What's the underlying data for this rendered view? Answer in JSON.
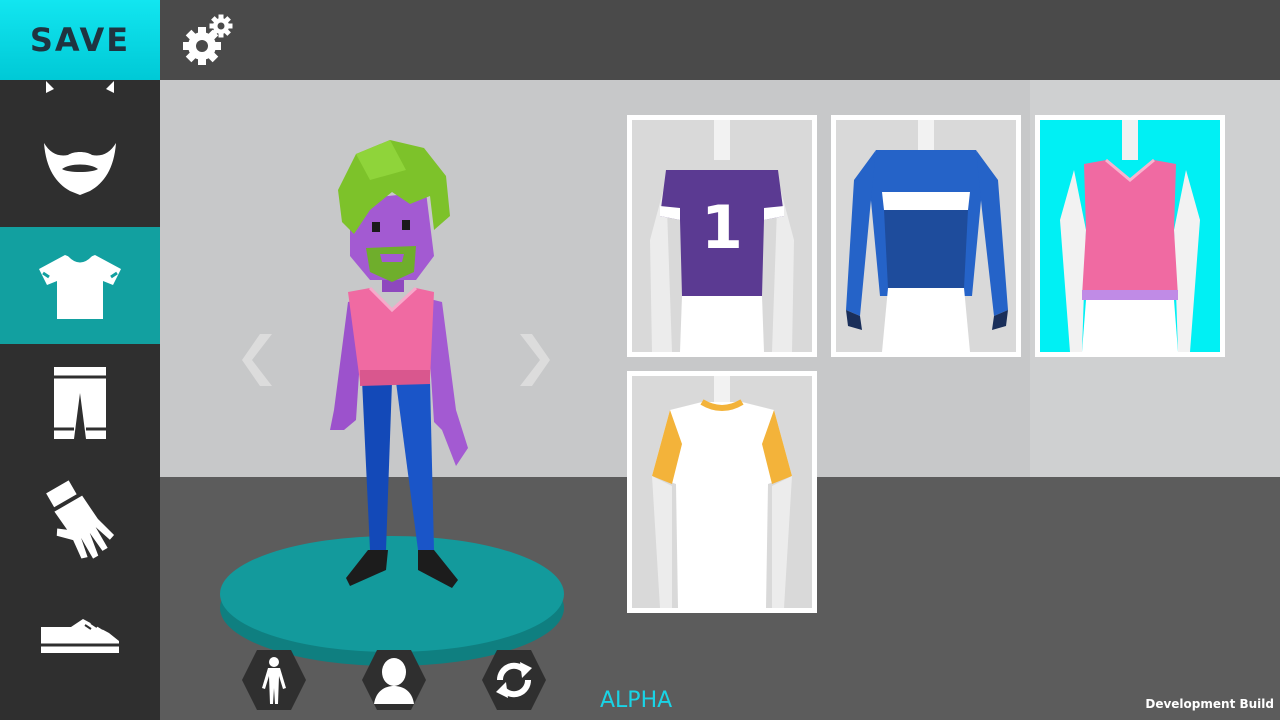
{
  "toolbar": {
    "save_label": "SAVE",
    "settings_icon": "gears-icon"
  },
  "sidebar": {
    "items": [
      {
        "name": "mustache",
        "icon": "mustache-icon",
        "active": false
      },
      {
        "name": "beard",
        "icon": "beard-icon",
        "active": false
      },
      {
        "name": "shirt",
        "icon": "shirt-icon",
        "active": true
      },
      {
        "name": "pants",
        "icon": "shorts-icon",
        "active": false
      },
      {
        "name": "gloves",
        "icon": "glove-icon",
        "active": false
      },
      {
        "name": "shoes",
        "icon": "shoe-icon",
        "active": false
      }
    ]
  },
  "avatar": {
    "hair": "#7dc22a",
    "skin": "#a35ad2",
    "shirt": "#f06aa2",
    "pants": "#1349b8",
    "platform": "#139a9c"
  },
  "tops": [
    {
      "name": "purple-jersey",
      "number": "1",
      "color": "#5b3a92",
      "selected": false
    },
    {
      "name": "blue-long-sleeve",
      "color": "#2563c8",
      "selected": false
    },
    {
      "name": "pink-tank-top",
      "color": "#f06aa2",
      "selected": true
    },
    {
      "name": "white-yellow-tee",
      "color": "#f3b33a",
      "selected": false
    }
  ],
  "colors": {
    "accent": "#00c9d6",
    "active_tab": "#12a0a0",
    "selected_card": "#00f0f4"
  },
  "footer": {
    "alpha_label": "ALPHA",
    "build_label": "Development Build"
  }
}
